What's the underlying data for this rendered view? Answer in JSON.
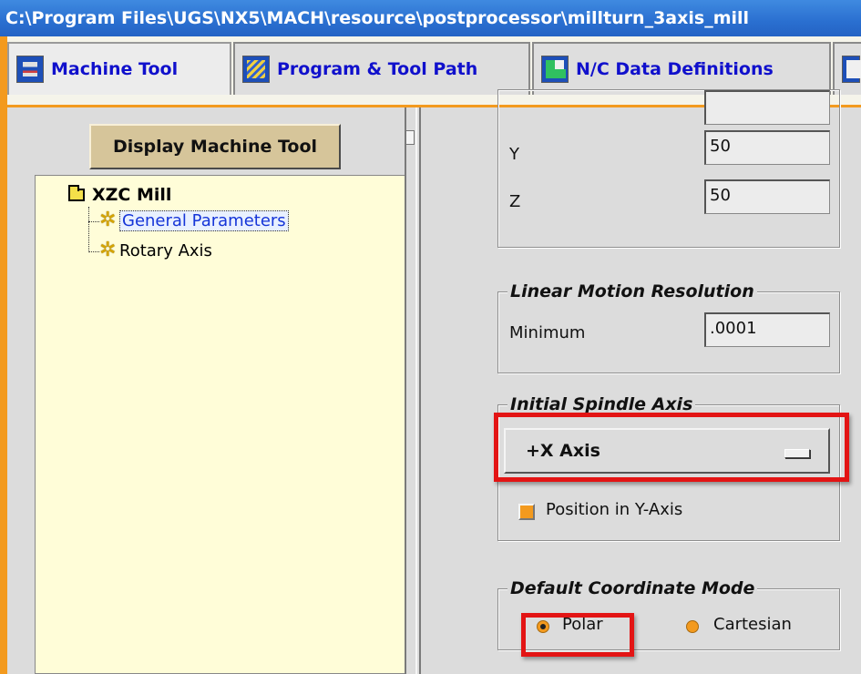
{
  "window": {
    "title": "C:\\Program Files\\UGS\\NX5\\MACH\\resource\\postprocessor\\millturn_3axis_mill"
  },
  "tabs": [
    {
      "label": "Machine Tool",
      "icon": "machine-tool-icon"
    },
    {
      "label": "Program & Tool Path",
      "icon": "program-tool-path-icon"
    },
    {
      "label": "N/C Data Definitions",
      "icon": "nc-data-icon"
    },
    {
      "label": "",
      "icon": "partial-tab-icon"
    }
  ],
  "left_pane": {
    "display_button_label": "Display Machine Tool",
    "tree": {
      "root_label": "XZC Mill",
      "items": [
        {
          "label": "General Parameters",
          "selected": true
        },
        {
          "label": "Rotary Axis",
          "selected": false
        }
      ]
    }
  },
  "right_pane": {
    "travel_limits": {
      "y_label": "Y",
      "y_value": "50",
      "z_label": "Z",
      "z_value": "50"
    },
    "linear_motion": {
      "title": "Linear Motion Resolution",
      "minimum_label": "Minimum",
      "minimum_value": ".0001"
    },
    "spindle": {
      "title": "Initial Spindle Axis",
      "selected_axis": "+X Axis",
      "position_label": "Position in Y-Axis"
    },
    "coordinate_mode": {
      "title": "Default Coordinate Mode",
      "polar_label": "Polar",
      "cartesian_label": "Cartesian",
      "selected": "Polar"
    }
  },
  "colors": {
    "titlebar": "#2a6fd0",
    "accent_orange": "#f39a1e",
    "tree_background": "#fffdd8",
    "highlight_red": "#e31414",
    "button_tan": "#d6c59a"
  }
}
